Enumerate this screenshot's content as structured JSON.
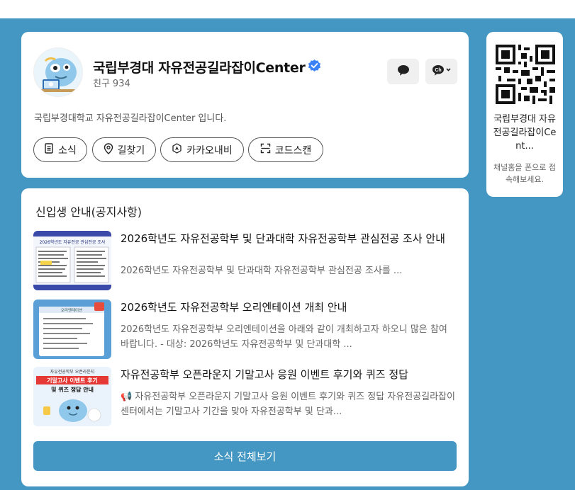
{
  "profile": {
    "channel_name": "국립부경대 자유전공길라잡이Center",
    "friends_label": "친구",
    "friends_count": "934",
    "description": "국립부경대학교 자유전공길라잡이Center 입니다.",
    "actions": [
      {
        "label": "소식",
        "icon": "document-icon"
      },
      {
        "label": "길찾기",
        "icon": "location-pin-icon"
      },
      {
        "label": "카카오내비",
        "icon": "navigation-icon"
      },
      {
        "label": "코드스캔",
        "icon": "scan-icon"
      }
    ]
  },
  "notice": {
    "section_title": "신입생 안내(공지사항)",
    "posts": [
      {
        "title": "2026학년도 자유전공학부 및 단과대학 자유전공학부 관심전공 조사 안내",
        "body": "2026학년도 자유전공학부 및 단과대학 자유전공학부 관심전공 조사를 ..."
      },
      {
        "title": "2026학년도 자유전공학부 오리엔테이션 개최 안내",
        "body": "2026학년도 자유전공학부 오리엔테이션을 아래와 같이 개최하고자 하오니 많은 참여 바랍니다. - 대상: 2026학년도 자유전공학부 및 단과대학 ..."
      },
      {
        "title": "자유전공학부 오픈라운지 기말고사 응원 이벤트 후기와 퀴즈 정답",
        "body": "📢 자유전공학부 오픈라운지 기말고사 응원 이벤트 후기와 퀴즈 정답 자유전공길라잡이센터에서는 기말고사 기간을 맞아 자유전공학부 및 단과..."
      }
    ],
    "thumb_texts": {
      "post1_banner": "2026학년도 자유전공 관심전공 조사",
      "post2_banner": "오리엔테이션",
      "post3_top": "자유전공학부 오픈라운지",
      "post3_line1": "기말고사 이벤트 후기",
      "post3_line2": "및 퀴즈 정답 안내"
    },
    "more_label": "소식 전체보기"
  },
  "qr": {
    "name": "국립부경대 자유전공길라잡이Cent...",
    "hint": "채널홈을 폰으로 접속해보세요."
  },
  "colors": {
    "background": "#4497c2",
    "verified": "#3b82f6",
    "button_bg": "#4497c2",
    "thumb3_red": "#e53935"
  }
}
